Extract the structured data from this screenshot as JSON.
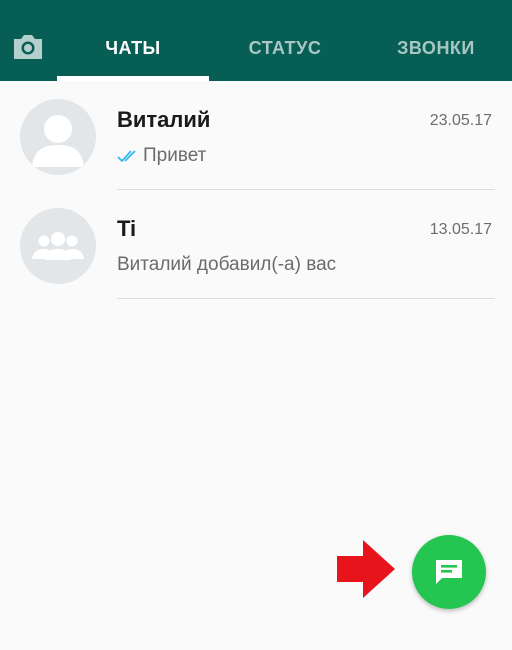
{
  "header": {
    "camera_icon": "camera-icon",
    "tabs": [
      {
        "label": "ЧАТЫ",
        "active": true
      },
      {
        "label": "СТАТУС",
        "active": false
      },
      {
        "label": "ЗВОНКИ",
        "active": false
      }
    ]
  },
  "chats": [
    {
      "name": "Виталий",
      "date": "23.05.17",
      "preview": "Привет",
      "avatar_icon": "person-avatar-icon",
      "status_icon": "double-check-icon"
    },
    {
      "name": "Ti",
      "date": "13.05.17",
      "preview": "Виталий добавил(-а) вас",
      "avatar_icon": "group-avatar-icon"
    }
  ],
  "fab": {
    "icon": "new-chat-icon"
  },
  "annotation": {
    "icon": "red-arrow-icon"
  },
  "colors": {
    "header": "#075e54",
    "accent_green": "#25c552",
    "tick_blue": "#34b7f1",
    "arrow_red": "#e8141c"
  }
}
